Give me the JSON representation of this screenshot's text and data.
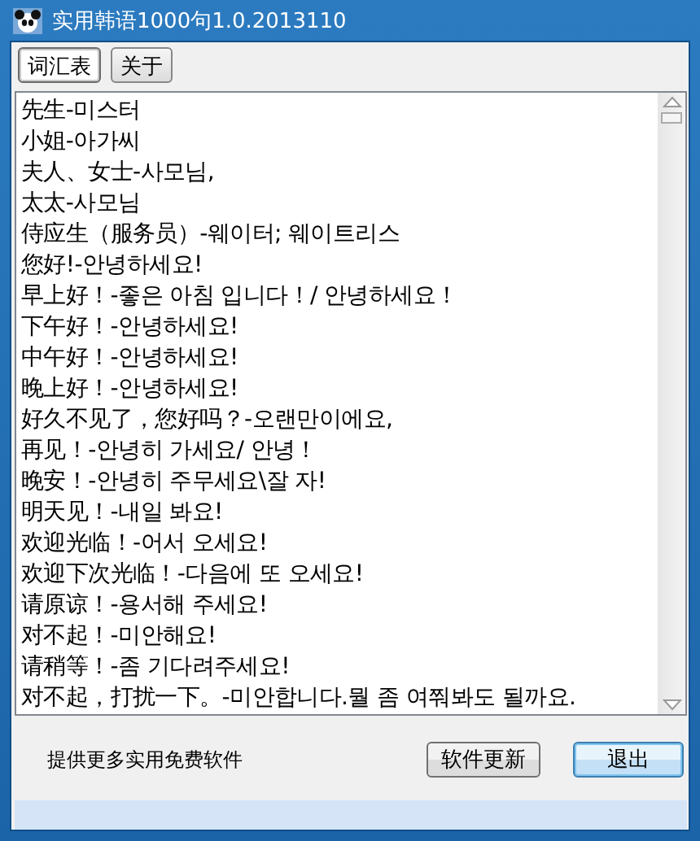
{
  "window": {
    "title": "实用韩语1000句1.0.2013110"
  },
  "tabs": [
    {
      "label": "词汇表",
      "selected": true
    },
    {
      "label": "关于",
      "selected": false
    }
  ],
  "phrases": [
    "先生-미스터",
    "小姐-아가씨",
    "夫人、女士-사모님,",
    "太太-사모님",
    "侍应生（服务员）-웨이터; 웨이트리스",
    "您好!-안녕하세요!",
    "早上好！-좋은 아침 입니다！/ 안녕하세요！",
    "下午好！-안녕하세요!",
    "中午好！-안녕하세요!",
    "晚上好！-안녕하세요!",
    "好久不见了，您好吗？-오랜만이에요,",
    "再见！-안녕히 가세요/ 안녕！",
    "晚安！-안녕히 주무세요\\잘 자!",
    "明天见！-내일 봐요!",
    "欢迎光临！-어서 오세요!",
    "欢迎下次光临！-다음에 또 오세요!",
    "请原谅！-용서해 주세요!",
    "对不起！-미안해요!",
    "请稍等！-좀 기다려주세요!",
    "对不起，打扰一下。-미안합니다.뭘 좀 여쭤봐도 될까요."
  ],
  "footer": {
    "text": "提供更多实用免费软件"
  },
  "buttons": [
    {
      "label": "软件更新",
      "default": false
    },
    {
      "label": "退出",
      "default": true
    }
  ]
}
